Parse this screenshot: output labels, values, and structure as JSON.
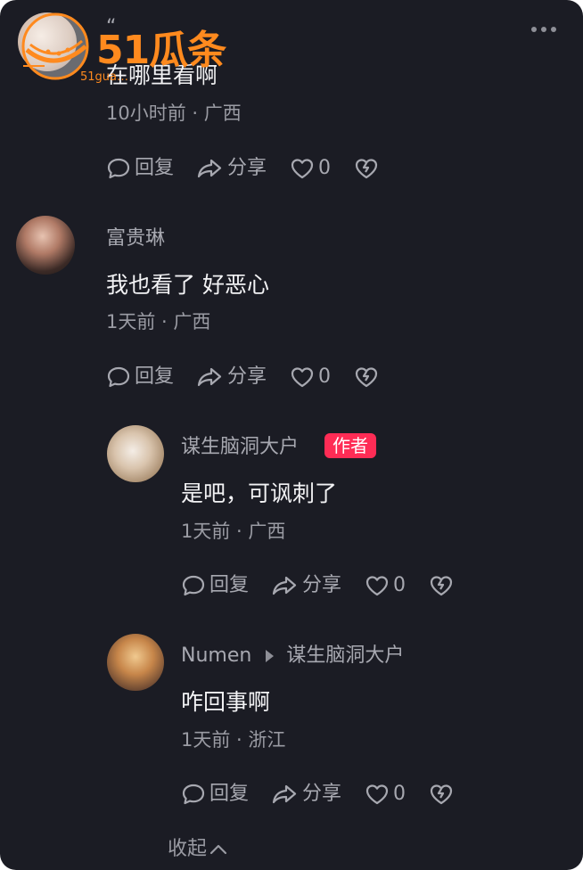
{
  "colors": {
    "background": "#1b1c24",
    "author_tag": "#fe2c55",
    "primary_text": "#f2f2f4",
    "secondary_text": "#a7a8b0"
  },
  "watermark": {
    "logo_text": "51瓜条",
    "url": "51gua…"
  },
  "comments": [
    {
      "name": "“",
      "text": "在哪里看啊",
      "meta": "10小时前 · 广西",
      "actions": {
        "reply": "回复",
        "share": "分享",
        "likes": "0"
      }
    },
    {
      "name": "富贵琳",
      "text": "我也看了 好恶心",
      "meta": "1天前 · 广西",
      "actions": {
        "reply": "回复",
        "share": "分享",
        "likes": "0"
      }
    }
  ],
  "replies": [
    {
      "name": "谋生脑洞大户",
      "tag": "作者",
      "text": "是吧，可讽刺了",
      "meta": "1天前 · 广西",
      "actions": {
        "reply": "回复",
        "share": "分享",
        "likes": "0"
      }
    },
    {
      "name": "Numen",
      "reply_to": "谋生脑洞大户",
      "text": "咋回事啊",
      "meta": "1天前 · 浙江",
      "actions": {
        "reply": "回复",
        "share": "分享",
        "likes": "0"
      }
    }
  ],
  "collapse_label": "收起"
}
